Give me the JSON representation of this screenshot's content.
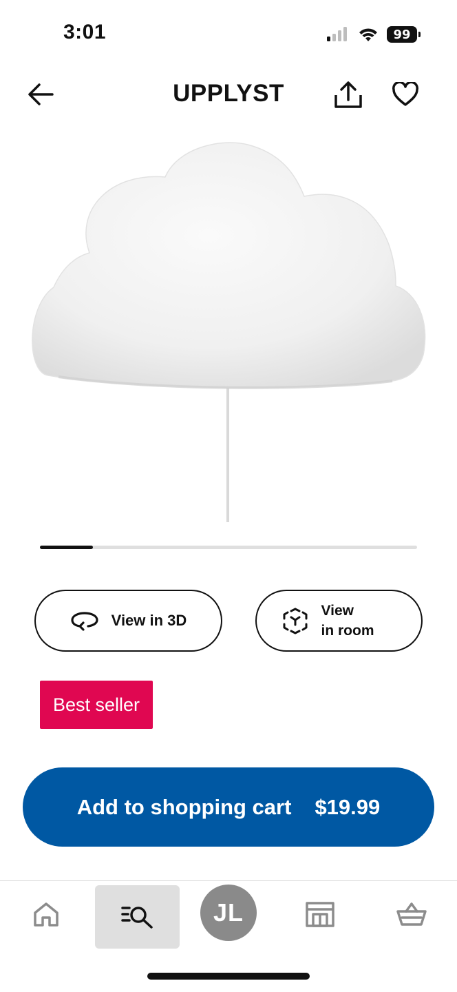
{
  "status_bar": {
    "time": "3:01",
    "battery": "99",
    "icons": [
      "cellular-signal-icon",
      "wifi-icon",
      "battery-icon"
    ]
  },
  "header": {
    "title": "UPPLYST",
    "icons": [
      "back-arrow-icon",
      "share-icon",
      "heart-icon"
    ]
  },
  "product": {
    "image": "cloud-wall-lamp-image",
    "carousel_progress": 0.14
  },
  "actions": {
    "view_3d_label": "View in 3D",
    "view_room_line1": "View",
    "view_room_line2": "in room",
    "icons": [
      "rotate-3d-icon",
      "ar-cube-icon"
    ]
  },
  "badge": {
    "label": "Best seller",
    "color": "#e00751"
  },
  "cta": {
    "label": "Add to shopping cart",
    "price": "$19.99",
    "color": "#0058a3"
  },
  "bottom_nav": {
    "items": [
      "home-icon",
      "search-list-icon",
      "profile-avatar",
      "store-icon",
      "basket-icon"
    ],
    "active": "search-list-icon",
    "avatar_initials": "JL"
  }
}
